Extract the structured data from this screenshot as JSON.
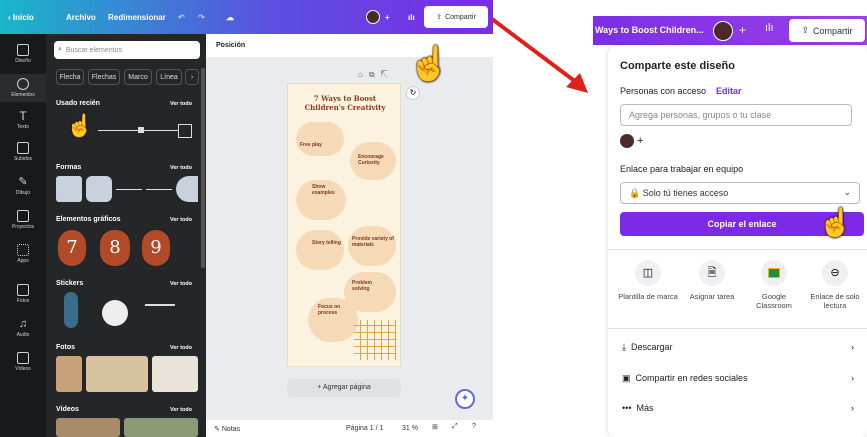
{
  "editor": {
    "topbar": {
      "home": "Inicio",
      "file": "Archivo",
      "resize": "Redimensionar",
      "plus": "+",
      "share": "Compartir"
    },
    "rail": [
      "Diseño",
      "Elementos",
      "Texto",
      "Subidos",
      "Dibujo",
      "Proyectos",
      "Apps",
      "Fotos",
      "Audio",
      "Vídeos"
    ],
    "search_placeholder": "Buscar elementos",
    "chips": [
      "Flecha",
      "Flechas",
      "Marco",
      "Línea"
    ],
    "sections": {
      "recent": "Usado recién",
      "shapes": "Formas",
      "graphics": "Elementos gráficos",
      "stickers": "Stickers",
      "photos": "Fotos",
      "videos": "Vídeos",
      "see_all": "Ver todo"
    },
    "graphic_digits": [
      "7",
      "8",
      "9"
    ],
    "position_label": "Posición",
    "poster": {
      "title": "7 Ways to Boost Children's Creativity",
      "items": [
        "Free play",
        "Encourage Curiosity",
        "Show examples",
        "Provide variety of materials",
        "Story telling",
        "Problem solving",
        "Focus on process"
      ]
    },
    "add_page": "+ Agregar página",
    "notes": "Notas",
    "page": "Página 1 / 1",
    "zoom": "31 %"
  },
  "share_panel": {
    "header_title": "Ways to Boost Children...",
    "plus": "+",
    "share_button": "Compartir",
    "title": "Comparte este diseño",
    "people_label": "Personas con acceso",
    "edit": "Editar",
    "input_placeholder": "Agrega personas, grupos o tu clase",
    "avatar_plus": "+",
    "link_label": "Enlace para trabajar en equipo",
    "access": "Solo tú tienes acceso",
    "copy_button": "Copiar el enlace",
    "options": [
      {
        "label": "Plantilla de marca",
        "icon": "template-icon"
      },
      {
        "label": "Asignar tarea",
        "icon": "assign-icon"
      },
      {
        "label": "Google Classroom",
        "icon": "classroom-icon"
      },
      {
        "label": "Enlace de solo lectura",
        "icon": "link-icon"
      }
    ],
    "menu": [
      {
        "label": "Descargar",
        "icon": "download-icon"
      },
      {
        "label": "Compartir en redes sociales",
        "icon": "social-icon"
      },
      {
        "label": "Más",
        "icon": "more-icon"
      }
    ]
  },
  "colors": {
    "accent": "#7d2ae8",
    "arrow": "#e0201b"
  }
}
